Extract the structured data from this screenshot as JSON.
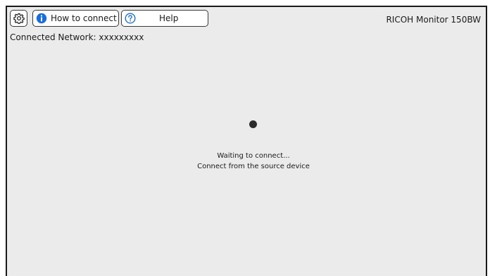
{
  "toolbar": {
    "settings_icon": "gear-icon",
    "how_to_connect": {
      "icon": "info-circle-icon",
      "label": "How to connect",
      "icon_color": "#1a6fd6"
    },
    "help": {
      "icon": "question-circle-icon",
      "label": "Help",
      "icon_color": "#1a6fd6"
    }
  },
  "header": {
    "monitor_name": "RICOH Monitor 150BW"
  },
  "network": {
    "text": "Connected Network: xxxxxxxxx"
  },
  "status": {
    "line1": "Waiting to connect...",
    "line2": "Connect from the source device"
  },
  "colors": {
    "background": "#ebebeb",
    "frame": "#1a1a1a",
    "accent": "#1a6fd6"
  }
}
